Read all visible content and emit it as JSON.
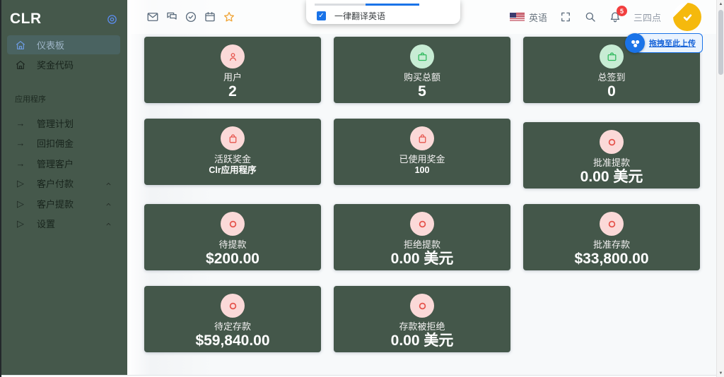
{
  "sidebar": {
    "logo": "CLR",
    "nav_items": [
      {
        "label": "仪表板",
        "icon": "home",
        "active": true
      },
      {
        "label": "奖金代码",
        "icon": "home",
        "active": false
      }
    ],
    "section_label": "应用程序",
    "app_items": [
      {
        "label": "管理计划",
        "icon": "arrow-right",
        "chevron": false
      },
      {
        "label": "回扣佣金",
        "icon": "arrow-right",
        "chevron": false
      },
      {
        "label": "管理客户",
        "icon": "arrow-right",
        "chevron": false
      },
      {
        "label": "客户付款",
        "icon": "play",
        "chevron": true
      },
      {
        "label": "客户提款",
        "icon": "play",
        "chevron": true
      },
      {
        "label": "设置",
        "icon": "play",
        "chevron": true
      }
    ]
  },
  "topbar": {
    "left_icons": [
      "mail",
      "chat",
      "check-circle",
      "calendar",
      "star"
    ],
    "language_label": "英语",
    "notification_badge": "5",
    "username": "三四点"
  },
  "translate_popup": {
    "label": "一律翻译英语",
    "checked": true
  },
  "upload_tooltip": {
    "label": "拖拽至此上传"
  },
  "dashboard": {
    "cards": [
      {
        "label": "用户",
        "value": "2",
        "icon": "user",
        "tone": "pink",
        "size": "big"
      },
      {
        "label": "购买总额",
        "value": "5",
        "icon": "briefcase",
        "tone": "green",
        "size": "big"
      },
      {
        "label": "总签到",
        "value": "0",
        "icon": "briefcase",
        "tone": "green",
        "size": "big"
      },
      {
        "label": "活跃奖金",
        "value": "Clr应用程序",
        "icon": "bag",
        "tone": "pink",
        "size": "small"
      },
      {
        "label": "已使用奖金",
        "value": "100",
        "icon": "bag",
        "tone": "pink",
        "size": "small"
      },
      {
        "label": "批准提款",
        "value": "0.00 美元",
        "icon": "ring",
        "tone": "pink",
        "size": "big",
        "offset": true
      },
      {
        "label": "待提款",
        "value": "$200.00",
        "icon": "ring",
        "tone": "pink",
        "size": "big"
      },
      {
        "label": "拒绝提款",
        "value": "0.00 美元",
        "icon": "ring",
        "tone": "pink",
        "size": "big"
      },
      {
        "label": "批准存款",
        "value": "$33,800.00",
        "icon": "ring",
        "tone": "pink",
        "size": "big"
      },
      {
        "label": "待定存款",
        "value": "$59,840.00",
        "icon": "ring",
        "tone": "pink",
        "size": "big"
      },
      {
        "label": "存款被拒绝",
        "value": "0.00 美元",
        "icon": "ring",
        "tone": "pink",
        "size": "big"
      }
    ]
  },
  "colors": {
    "sidebar_green": "#45584b",
    "card_green": "#44574a",
    "accent_blue": "#1a73e8",
    "active_item_bg": "#4a6361",
    "badge_red": "#f23f3f",
    "star_orange": "#f0a63a",
    "avatar_yellow": "#f5b90d",
    "pink_circle": "#fbd9d8",
    "icon_red": "#e5534b",
    "mint_circle": "#c7ecd4",
    "icon_green": "#2eb85c"
  }
}
